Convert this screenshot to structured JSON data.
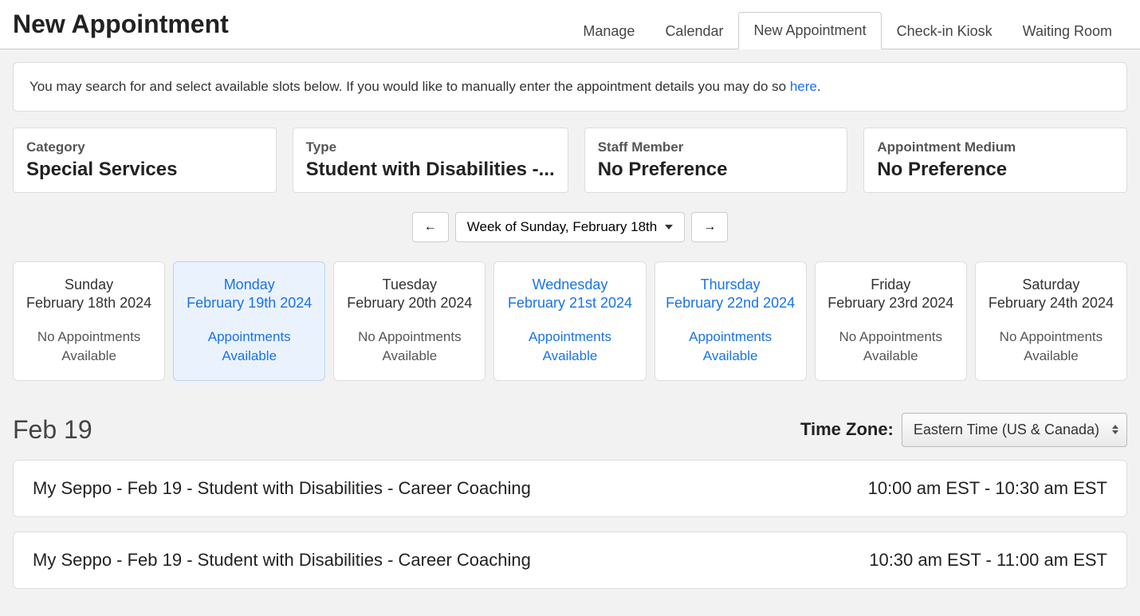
{
  "header": {
    "title": "New Appointment",
    "tabs": [
      {
        "id": "manage",
        "label": "Manage",
        "active": false
      },
      {
        "id": "calendar",
        "label": "Calendar",
        "active": false
      },
      {
        "id": "new-appointment",
        "label": "New Appointment",
        "active": true
      },
      {
        "id": "checkin-kiosk",
        "label": "Check-in Kiosk",
        "active": false
      },
      {
        "id": "waiting-room",
        "label": "Waiting Room",
        "active": false
      }
    ]
  },
  "info": {
    "text_before_link": "You may search for and select available slots below. If you would like to manually enter the appointment details you may do so ",
    "link_text": "here",
    "text_after_link": "."
  },
  "filters": {
    "category": {
      "label": "Category",
      "value": "Special Services"
    },
    "type": {
      "label": "Type",
      "value": "Student with Disabilities -..."
    },
    "staff": {
      "label": "Staff Member",
      "value": "No Preference"
    },
    "medium": {
      "label": "Appointment Medium",
      "value": "No Preference"
    }
  },
  "week_nav": {
    "label": "Week of Sunday, February 18th"
  },
  "days": [
    {
      "id": "sun",
      "name": "Sunday",
      "date": "February 18th 2024",
      "status": "No Appointments Available",
      "has_appts": false,
      "selected": false
    },
    {
      "id": "mon",
      "name": "Monday",
      "date": "February 19th 2024",
      "status": "Appointments Available",
      "has_appts": true,
      "selected": true
    },
    {
      "id": "tue",
      "name": "Tuesday",
      "date": "February 20th 2024",
      "status": "No Appointments Available",
      "has_appts": false,
      "selected": false
    },
    {
      "id": "wed",
      "name": "Wednesday",
      "date": "February 21st 2024",
      "status": "Appointments Available",
      "has_appts": true,
      "selected": false
    },
    {
      "id": "thu",
      "name": "Thursday",
      "date": "February 22nd 2024",
      "status": "Appointments Available",
      "has_appts": true,
      "selected": false
    },
    {
      "id": "fri",
      "name": "Friday",
      "date": "February 23rd 2024",
      "status": "No Appointments Available",
      "has_appts": false,
      "selected": false
    },
    {
      "id": "sat",
      "name": "Saturday",
      "date": "February 24th 2024",
      "status": "No Appointments Available",
      "has_appts": false,
      "selected": false
    }
  ],
  "slots": {
    "heading": "Feb 19",
    "timezone_label": "Time Zone:",
    "timezone_value": "Eastern Time (US & Canada)",
    "list": [
      {
        "title": "My Seppo - Feb 19 - Student with Disabilities - Career Coaching",
        "time": "10:00 am EST - 10:30 am EST"
      },
      {
        "title": "My Seppo - Feb 19 - Student with Disabilities - Career Coaching",
        "time": "10:30 am EST - 11:00 am EST"
      }
    ]
  }
}
